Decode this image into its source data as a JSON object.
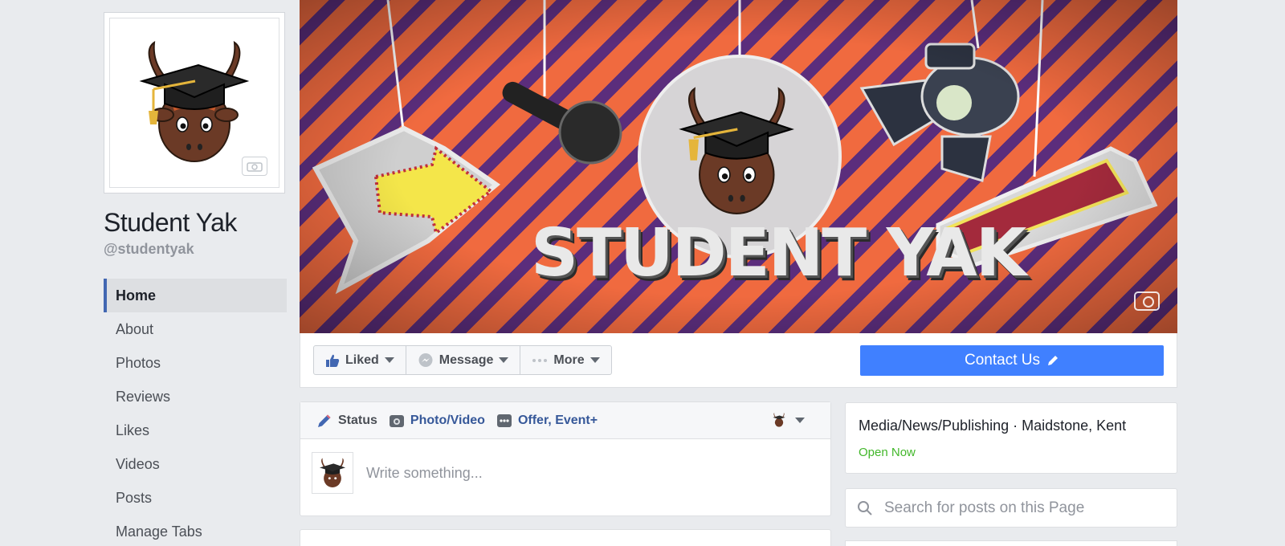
{
  "profile": {
    "name": "Student Yak",
    "handle": "@studentyak"
  },
  "nav": {
    "items": [
      {
        "label": "Home",
        "active": true
      },
      {
        "label": "About"
      },
      {
        "label": "Photos"
      },
      {
        "label": "Reviews"
      },
      {
        "label": "Likes"
      },
      {
        "label": "Videos"
      },
      {
        "label": "Posts"
      },
      {
        "label": "Manage Tabs"
      }
    ]
  },
  "cover": {
    "title": "STUDENT YAK",
    "colors": {
      "stripe_orange": "#f06a3f",
      "stripe_purple": "#5b2d7c"
    }
  },
  "actions": {
    "liked_label": "Liked",
    "message_label": "Message",
    "more_label": "More",
    "contact_label": "Contact Us",
    "contact_color": "#4080ff"
  },
  "composer": {
    "tabs": {
      "status": "Status",
      "photo_video": "Photo/Video",
      "offer_event": "Offer, Event+"
    },
    "placeholder": "Write something..."
  },
  "info": {
    "category_location": "Media/News/Publishing · Maidstone, Kent",
    "open_status": "Open Now"
  },
  "search": {
    "placeholder": "Search for posts on this Page"
  }
}
